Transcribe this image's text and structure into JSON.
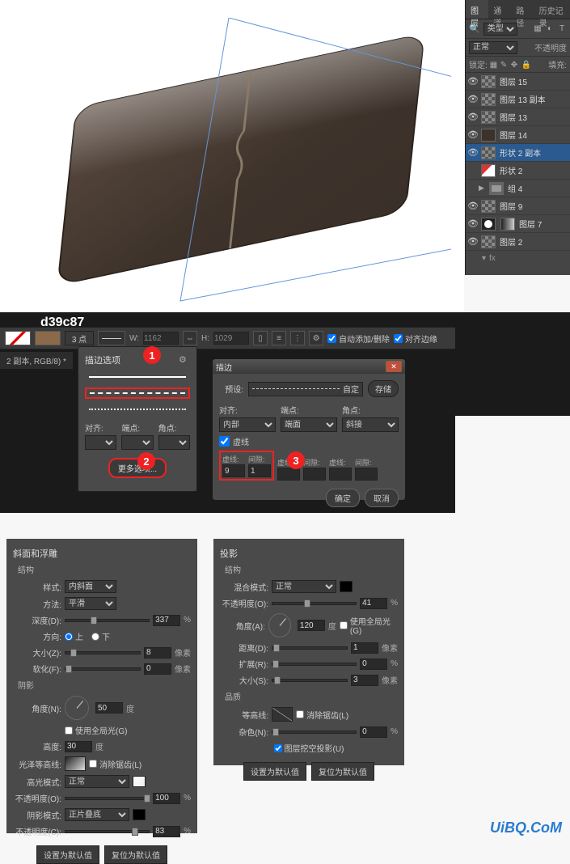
{
  "watermark": "d39c87",
  "site_watermark": "UiBQ.CoM",
  "layers_panel": {
    "tabs": [
      "图层",
      "通道",
      "路径",
      "历史记录"
    ],
    "active_tab": 0,
    "kind_dropdown": "类型",
    "blend_mode": "正常",
    "opacity_label": "不透明度",
    "lock_label": "锁定:",
    "fill_label": "填充:",
    "layers": [
      {
        "visible": true,
        "name": "图层 15",
        "thumb": "checker"
      },
      {
        "visible": true,
        "name": "图层 13 副本",
        "thumb": "checker"
      },
      {
        "visible": true,
        "name": "图层 13",
        "thumb": "checker"
      },
      {
        "visible": true,
        "name": "图层 14",
        "thumb": "dark"
      },
      {
        "visible": true,
        "name": "形状 2 副本",
        "thumb": "checker",
        "selected": true
      },
      {
        "visible": false,
        "name": "形状 2",
        "thumb": "red"
      },
      {
        "visible": false,
        "name": "组 4",
        "thumb": "folder",
        "group": true
      },
      {
        "visible": true,
        "name": "图层 9",
        "thumb": "checker"
      },
      {
        "visible": true,
        "name": "图层 7",
        "thumb": "mask",
        "grad": true
      },
      {
        "visible": true,
        "name": "图层 2",
        "thumb": "checker"
      }
    ],
    "fx_line": "fx"
  },
  "shape_toolbar": {
    "stroke_width": "3 点",
    "w_label": "W:",
    "w_val": "1162",
    "h_label": "H:",
    "h_val": "1029",
    "auto_add": "自动添加/删除",
    "align_edges": "对齐边缘"
  },
  "doc_tab": "2 副本, RGB/8) *",
  "badges": {
    "one": "1",
    "two": "2",
    "three": "3"
  },
  "stroke_popup": {
    "title": "描边选项",
    "align_label": "对齐:",
    "caps_label": "端点:",
    "corners_label": "角点:",
    "more_button": "更多选项..."
  },
  "stroke_dialog": {
    "title": "描边",
    "preset_label": "预设:",
    "preset_value": "自定",
    "save_btn": "存储",
    "align_label": "对齐:",
    "align_value": "内部",
    "caps_label": "端点:",
    "caps_value": "端面",
    "corners_label": "角点:",
    "corners_value": "斜接",
    "dash_check": "虚线",
    "cols": {
      "dash": "虚线:",
      "gap": "间隙:"
    },
    "dash1": "9",
    "gap1": "1",
    "ok": "确定",
    "cancel": "取消"
  },
  "bevel_panel": {
    "title": "斜面和浮雕",
    "structure_label": "结构",
    "style_label": "样式:",
    "style_value": "内斜面",
    "technique_label": "方法:",
    "technique_value": "平滑",
    "depth_label": "深度(D):",
    "depth_value": "337",
    "depth_unit": "%",
    "direction_label": "方向:",
    "dir_up": "上",
    "dir_down": "下",
    "size_label": "大小(Z):",
    "size_value": "8",
    "size_unit": "像素",
    "soften_label": "软化(F):",
    "soften_value": "0",
    "soften_unit": "像素",
    "shading_label": "阴影",
    "angle_label": "角度(N):",
    "angle_value": "50",
    "angle_unit": "度",
    "use_global": "使用全局光(G)",
    "altitude_label": "高度:",
    "altitude_value": "30",
    "altitude_unit": "度",
    "gloss_label": "光泽等高线:",
    "antialias": "消除锯齿(L)",
    "highlight_mode_label": "高光模式:",
    "highlight_mode_value": "正常",
    "highlight_opacity_label": "不透明度(O):",
    "highlight_opacity_value": "100",
    "hunit": "%",
    "shadow_mode_label": "阴影模式:",
    "shadow_mode_value": "正片叠底",
    "shadow_opacity_label": "不透明度(C):",
    "shadow_opacity_value": "83",
    "sunit": "%",
    "set_default": "设置为默认值",
    "reset_default": "复位为默认值"
  },
  "shadow_panel": {
    "title": "投影",
    "structure_label": "结构",
    "blend_label": "混合模式:",
    "blend_value": "正常",
    "opacity_label": "不透明度(O):",
    "opacity_value": "41",
    "opacity_unit": "%",
    "angle_label": "角度(A):",
    "angle_value": "120",
    "angle_unit": "度",
    "use_global": "使用全局光(G)",
    "distance_label": "距离(D):",
    "distance_value": "1",
    "distance_unit": "像素",
    "spread_label": "扩展(R):",
    "spread_value": "0",
    "spread_unit": "%",
    "size_label": "大小(S):",
    "size_value": "3",
    "size_unit": "像素",
    "quality_label": "品质",
    "contour_label": "等高线:",
    "antialias": "消除锯齿(L)",
    "noise_label": "杂色(N):",
    "noise_value": "0",
    "noise_unit": "%",
    "knockout": "图层挖空投影(U)",
    "set_default": "设置为默认值",
    "reset_default": "复位为默认值"
  }
}
